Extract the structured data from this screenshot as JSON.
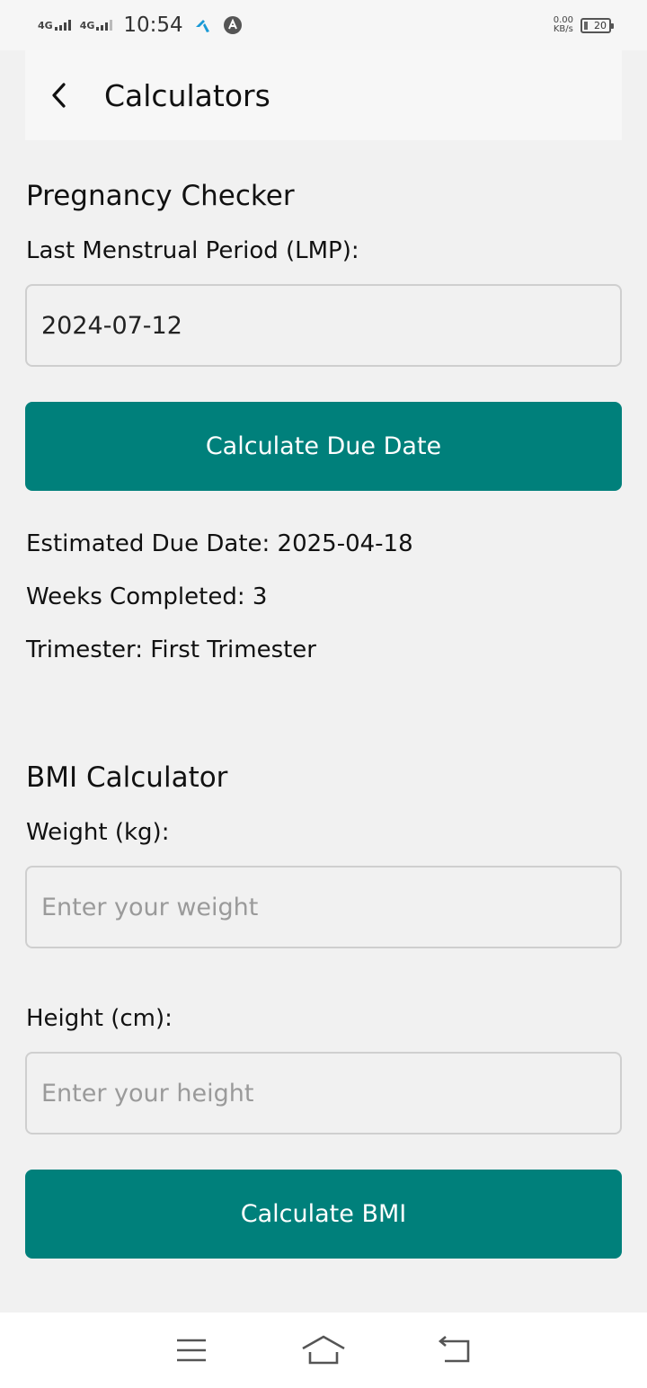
{
  "status_bar": {
    "network1": "4G",
    "network2": "4G",
    "time": "10:54",
    "speed_value": "0.00",
    "speed_unit": "KB/s",
    "battery": "20"
  },
  "header": {
    "title": "Calculators"
  },
  "pregnancy": {
    "title": "Pregnancy Checker",
    "lmp_label": "Last Menstrual Period (LMP):",
    "lmp_value": "2024-07-12",
    "calculate_label": "Calculate Due Date",
    "due_date": "Estimated Due Date: 2025-04-18",
    "weeks": "Weeks Completed: 3",
    "trimester": "Trimester: First Trimester"
  },
  "bmi": {
    "title": "BMI Calculator",
    "weight_label": "Weight (kg):",
    "weight_placeholder": "Enter your weight",
    "height_label": "Height (cm):",
    "height_placeholder": "Enter your height",
    "calculate_label": "Calculate BMI"
  },
  "colors": {
    "primary": "#00807b",
    "background": "#f1f1f1"
  }
}
